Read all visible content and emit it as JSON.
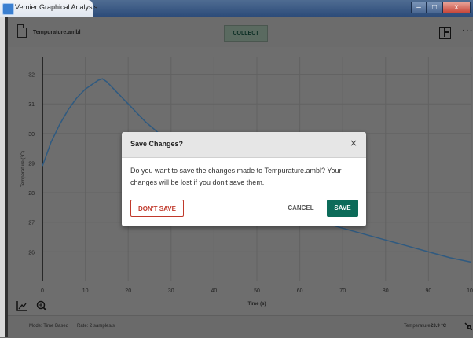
{
  "window": {
    "title": "Vernier Graphical Analysis",
    "minimize": "–",
    "maximize": "□",
    "close": "x"
  },
  "toolbar": {
    "file_name": "Tempurature.ambl",
    "collect_label": "COLLECT",
    "more_label": "···"
  },
  "chart_data": {
    "type": "line",
    "xlabel": "Time (s)",
    "ylabel": "Temperature (°C)",
    "xlim": [
      0,
      100
    ],
    "ylim": [
      25,
      32.6
    ],
    "x_ticks": [
      "0",
      "10",
      "20",
      "30",
      "40",
      "50",
      "60",
      "70",
      "80",
      "90",
      "100"
    ],
    "y_ticks": [
      "26",
      "27",
      "28",
      "29",
      "30",
      "31",
      "32"
    ],
    "grid": true,
    "line_color": "#2f5a80",
    "series": [
      {
        "x": [
          0,
          1,
          2,
          3,
          4,
          5,
          6,
          7,
          8,
          9,
          10,
          11,
          12,
          13,
          14,
          15,
          16,
          17,
          18,
          19,
          20,
          22,
          24,
          26,
          28,
          30,
          33,
          36,
          40,
          45,
          50,
          55,
          60,
          65,
          70,
          75,
          80,
          85,
          90,
          95,
          100
        ],
        "y": [
          28.9,
          29.3,
          29.7,
          30.0,
          30.3,
          30.55,
          30.8,
          31.0,
          31.2,
          31.35,
          31.5,
          31.6,
          31.7,
          31.8,
          31.85,
          31.75,
          31.6,
          31.45,
          31.3,
          31.15,
          31.0,
          30.7,
          30.4,
          30.15,
          29.9,
          29.7,
          29.4,
          29.1,
          28.7,
          28.3,
          27.9,
          27.55,
          27.25,
          27.0,
          26.8,
          26.6,
          26.4,
          26.2,
          26.0,
          25.8,
          25.65
        ]
      }
    ]
  },
  "bottom": {
    "graph_tool_icon": "graph-tools-icon",
    "zoom_icon": "zoom-icon"
  },
  "status": {
    "mode": "Mode: Time Based",
    "rate": "Rate: 2 samples/s",
    "temperature_label": "Temperature:",
    "temperature_value": "23.9 °C"
  },
  "dialog": {
    "title": "Save Changes?",
    "close": "×",
    "message": "Do you want to save the changes made to Tempurature.ambl? Your changes will be lost if you don't save them.",
    "dont_save": "DON'T SAVE",
    "cancel": "CANCEL",
    "save": "SAVE"
  },
  "colors": {
    "accent": "#0c6b59",
    "danger": "#c0392b"
  }
}
